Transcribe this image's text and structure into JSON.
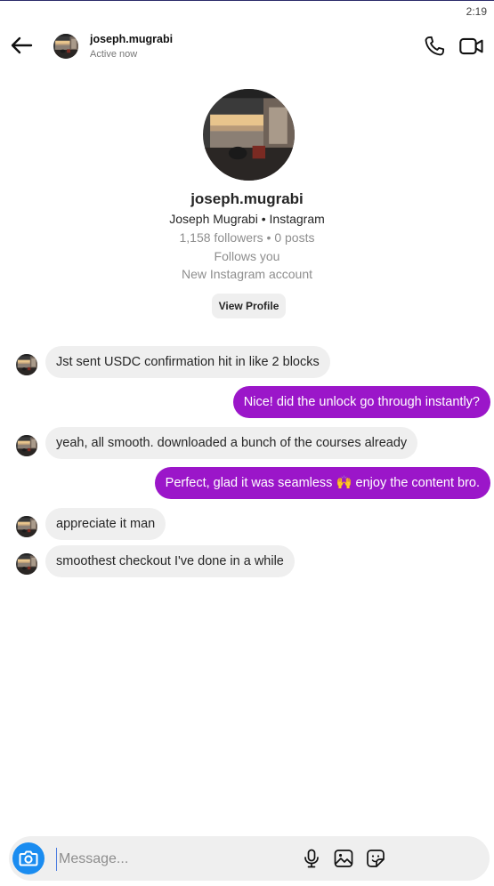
{
  "status_bar": {
    "time": "2:19"
  },
  "header": {
    "username": "joseph.mugrabi",
    "status": "Active now",
    "icons": {
      "back": "arrow-left-icon",
      "call": "phone-icon",
      "video": "video-camera-icon"
    }
  },
  "profile": {
    "username": "joseph.mugrabi",
    "full_name_line": "Joseph Mugrabi • Instagram",
    "stats_line": "1,158 followers • 0 posts",
    "follows_line": "Follows you",
    "account_note": "New Instagram account",
    "view_profile_label": "View Profile"
  },
  "messages": [
    {
      "direction": "incoming",
      "text": "Jst sent USDC  confirmation hit in like 2 blocks"
    },
    {
      "direction": "outgoing",
      "text": "Nice! did the unlock go through instantly?"
    },
    {
      "direction": "incoming",
      "text": "yeah, all smooth. downloaded a bunch of the  courses already"
    },
    {
      "direction": "outgoing",
      "text": "Perfect, glad it was seamless 🙌 enjoy the content bro."
    },
    {
      "direction": "incoming",
      "text": "appreciate it man"
    },
    {
      "direction": "incoming",
      "text": "smoothest checkout I've done in a while"
    }
  ],
  "composer": {
    "placeholder": "Message...",
    "icons": {
      "camera": "camera-icon",
      "mic": "microphone-icon",
      "gallery": "image-icon",
      "sticker": "sticker-icon"
    }
  },
  "colors": {
    "outgoing_bubble": "#9b16c9",
    "incoming_bubble": "#efefef",
    "camera_button": "#1a8cf0"
  }
}
